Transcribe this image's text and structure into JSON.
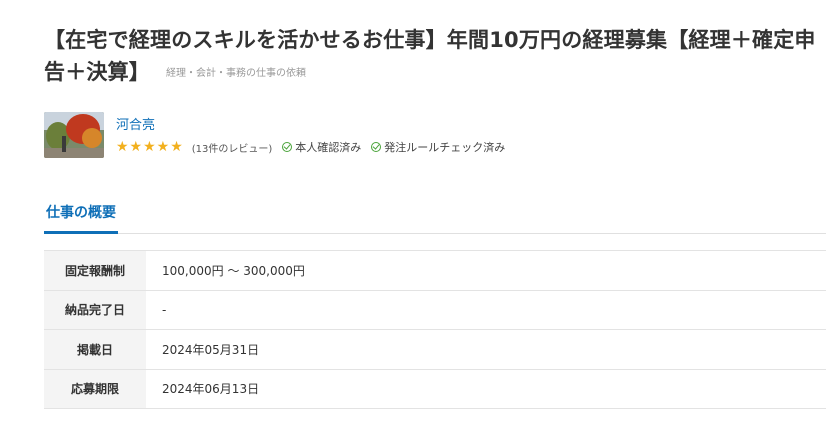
{
  "job": {
    "title": "【在宅で経理のスキルを活かせるお仕事】年間10万円の経理募集【経理＋確定申告＋決算】",
    "category": "経理・会計・事務の仕事の依頼"
  },
  "client": {
    "name": "河合亮",
    "rating_stars": "★★★★★",
    "rating": 5,
    "review_count": "(13件のレビュー)",
    "badges": [
      "本人確認済み",
      "発注ルールチェック済み"
    ]
  },
  "tabs": {
    "overview": "仕事の概要"
  },
  "overview": {
    "rows": [
      {
        "label": "固定報酬制",
        "value": "100,000円 〜 300,000円"
      },
      {
        "label": "納品完了日",
        "value": "-"
      },
      {
        "label": "掲載日",
        "value": "2024年05月31日"
      },
      {
        "label": "応募期限",
        "value": "2024年06月13日"
      }
    ]
  },
  "colors": {
    "accent": "#0f6fb7",
    "star": "#f2b01e",
    "check": "#4aa33a"
  }
}
